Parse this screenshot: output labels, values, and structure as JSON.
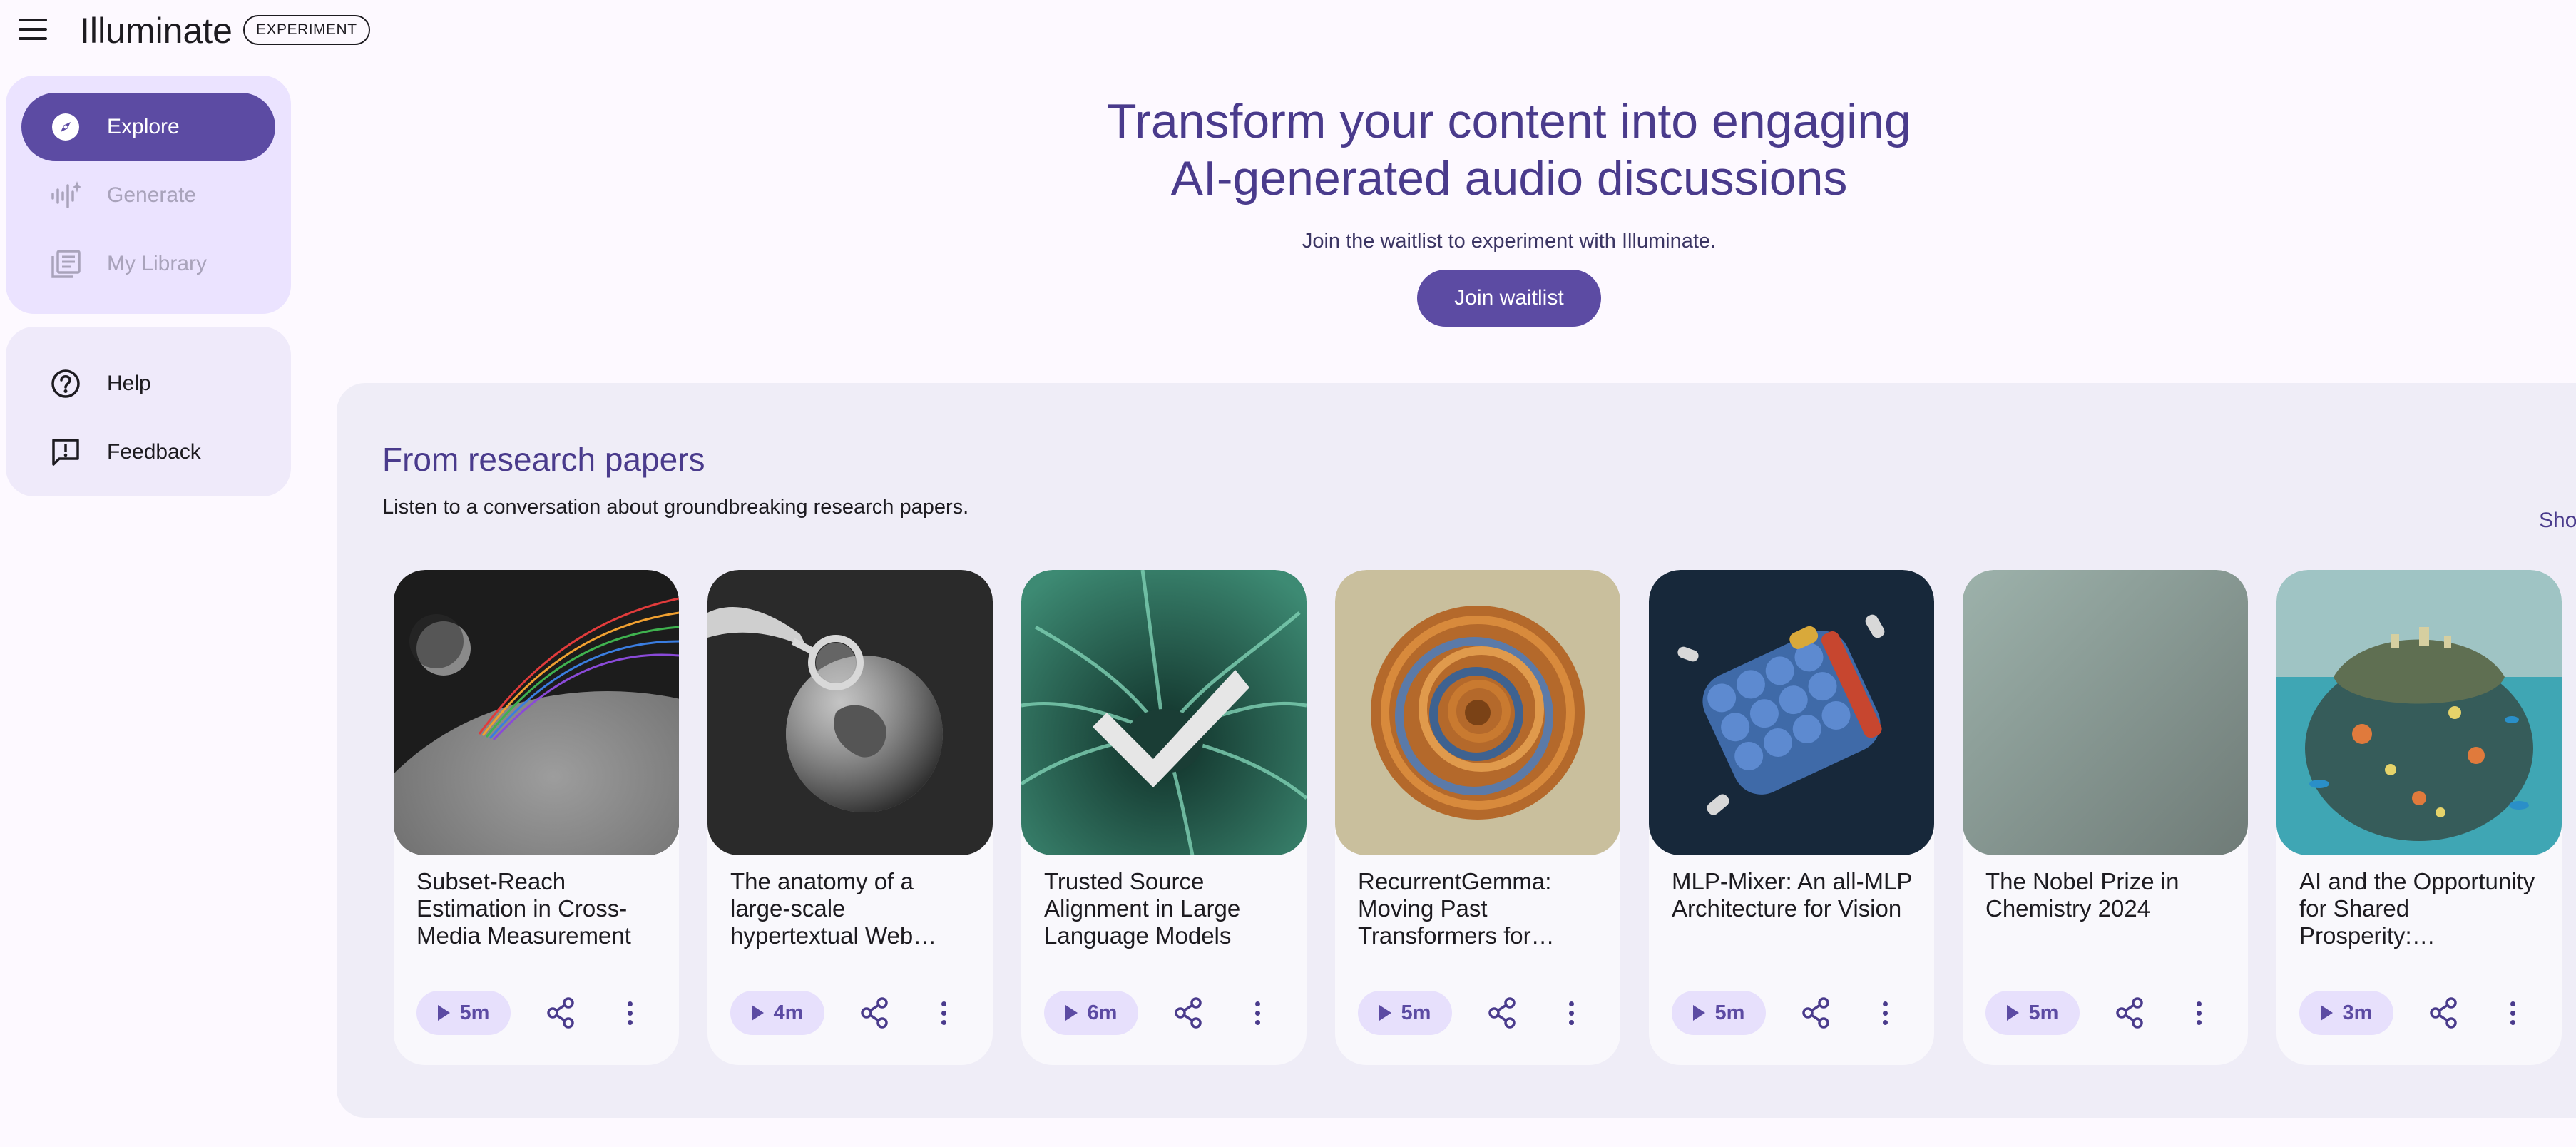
{
  "header": {
    "app_title": "Illuminate",
    "badge": "EXPERIMENT"
  },
  "sidebar": {
    "primary": [
      {
        "label": "Explore",
        "icon": "compass-icon",
        "state": "active"
      },
      {
        "label": "Generate",
        "icon": "audio-spark-icon",
        "state": "disabled"
      },
      {
        "label": "My Library",
        "icon": "library-icon",
        "state": "disabled"
      }
    ],
    "secondary": [
      {
        "label": "Help",
        "icon": "help-circle-icon"
      },
      {
        "label": "Feedback",
        "icon": "feedback-icon"
      }
    ]
  },
  "hero": {
    "title_line1": "Transform your content into engaging",
    "title_line2": "AI-generated audio discussions",
    "subtitle": "Join the waitlist to experiment with Illuminate.",
    "cta": "Join waitlist"
  },
  "section": {
    "title": "From research papers",
    "description": "Listen to a conversation about groundbreaking research papers.",
    "show_all": "Sho",
    "cards": [
      {
        "title": "Subset-Reach Estimation in Cross-Media Measurement",
        "duration": "5m",
        "art": "planet-rainbow"
      },
      {
        "title": "The anatomy of a large-scale hypertextual Web…",
        "duration": "4m",
        "art": "magnifier-globe"
      },
      {
        "title": "Trusted Source Alignment in Large Language Models",
        "duration": "6m",
        "art": "neuron-checkmark"
      },
      {
        "title": "RecurrentGemma: Moving Past Transformers for…",
        "duration": "5m",
        "art": "spiral-shell"
      },
      {
        "title": "MLP-Mixer: An all-MLP Architecture for Vision",
        "duration": "5m",
        "art": "molecular-structure"
      },
      {
        "title": "The Nobel Prize in Chemistry 2024",
        "duration": "5m",
        "art": "gray-gradient"
      },
      {
        "title": "AI and the Opportunity for Shared Prosperity:…",
        "duration": "3m",
        "art": "coral-island"
      }
    ]
  },
  "colors": {
    "accent": "#5c4ba3",
    "title": "#4a3b8c",
    "background": "#fdf9ff",
    "section_bg": "#efedf7"
  }
}
